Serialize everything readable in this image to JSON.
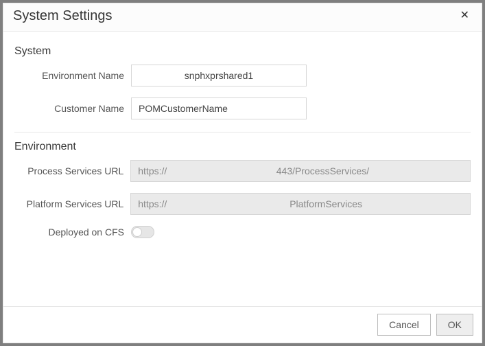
{
  "dialog": {
    "title": "System Settings"
  },
  "system": {
    "heading": "System",
    "environment_name_label": "Environment Name",
    "environment_name_value": "snphxprshared1",
    "customer_name_label": "Customer Name",
    "customer_name_value": "POMCustomerName"
  },
  "environment": {
    "heading": "Environment",
    "process_services_label": "Process Services URL",
    "process_services_value": "https://                                         443/ProcessServices/",
    "platform_services_label": "Platform Services URL",
    "platform_services_value": "https://                                              PlatformServices",
    "deployed_on_cfs_label": "Deployed on CFS",
    "deployed_on_cfs_value": false
  },
  "buttons": {
    "cancel": "Cancel",
    "ok": "OK"
  }
}
